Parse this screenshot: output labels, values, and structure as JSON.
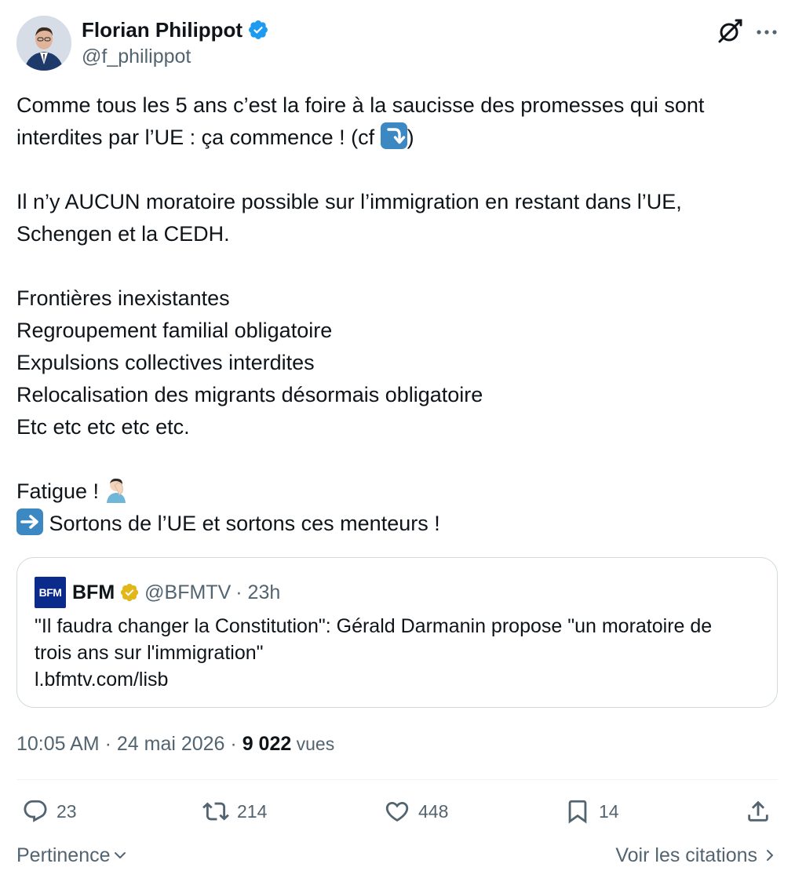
{
  "author": {
    "display_name": "Florian Philippot",
    "handle": "@f_philippot"
  },
  "body": {
    "p1": {
      "line1": "Comme tous les 5 ans c’est la foire à la saucisse des promesses qui sont",
      "line2_before": "interdites par l’UE : ça commence ! (cf ",
      "line2_after": ")"
    },
    "p2": {
      "line1": "Il n’y AUCUN moratoire possible sur l’immigration en restant dans l’UE,",
      "line2": "Schengen et la CEDH."
    },
    "p3": [
      "Frontières inexistantes",
      "Regroupement familial obligatoire",
      "Expulsions collectives interdites",
      "Relocalisation des migrants désormais obligatoire",
      "Etc etc etc etc etc."
    ],
    "p4": {
      "fatigue": "Fatigue ! ",
      "sortons": " Sortons de l’UE et sortons ces menteurs !"
    }
  },
  "icons": {
    "verified": "verified-badge-icon",
    "grok": "grok-icon",
    "more": "more-icon",
    "arrow_down": "arrow-curving-down-icon",
    "arrow_right": "arrow-right-icon",
    "facepalm": "facepalm-emoji-icon"
  },
  "quote": {
    "logo_text": "BFM",
    "name": "BFM",
    "handle": "@BFMTV",
    "time": "· 23h",
    "text_line1": "\"Il faudra changer la Constitution\": Gérald Darmanin propose \"un moratoire de",
    "text_line2": "trois ans sur l'immigration\"",
    "link": "l.bfmtv.com/lisb"
  },
  "meta": {
    "time": "10:05 AM",
    "sep1": " · ",
    "date": "24 mai 2026",
    "sep2": " · ",
    "views": "9 022",
    "views_label": " vues"
  },
  "actions": {
    "replies": "23",
    "reposts": "214",
    "likes": "448",
    "bookmarks": "14"
  },
  "footer": {
    "sort": "Pertinence",
    "quotes": "Voir les citations"
  },
  "colors": {
    "text": "#0f1419",
    "secondary": "#536471",
    "verified_blue": "#1d9bf0",
    "verified_gold": "#e2b719",
    "border": "#cfd9de",
    "bfm_blue": "#0a2a8c"
  }
}
